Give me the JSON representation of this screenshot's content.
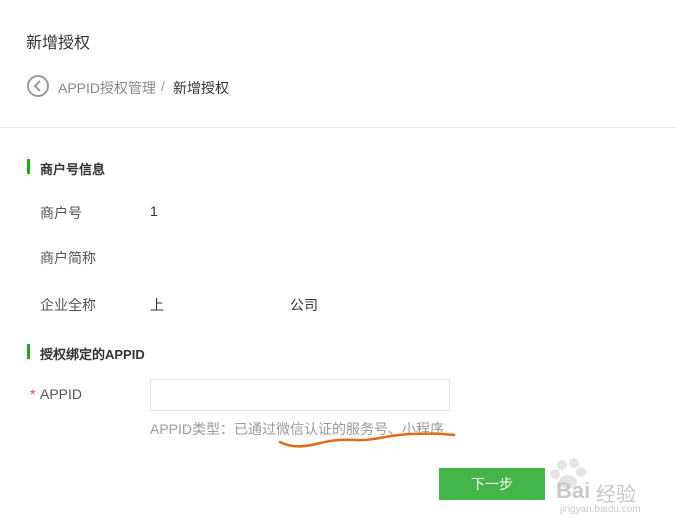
{
  "header": {
    "title": "新增授权"
  },
  "breadcrumb": {
    "parent": "APPID授权管理",
    "separator": "/",
    "current": "新增授权"
  },
  "merchant_section": {
    "title": "商户号信息",
    "rows": [
      {
        "label": "商户号",
        "value": "1"
      },
      {
        "label": "商户简称",
        "value": ""
      },
      {
        "label": "企业全称",
        "value": "上"
      }
    ],
    "company_suffix": "公司"
  },
  "appid_section": {
    "title": "授权绑定的APPID",
    "required_mark": "*",
    "label": "APPID",
    "input_value": "",
    "hint": "APPID类型：已通过微信认证的服务号、小程序"
  },
  "actions": {
    "next_label": "下一步"
  },
  "watermark": {
    "brand": "Bai",
    "brand_cn": "经验",
    "url": "jingyan.baidu.com"
  },
  "colors": {
    "accent": "#44b549",
    "section_bar": "#1aad19",
    "annotation": "#e06a1b",
    "required": "#e64340"
  }
}
